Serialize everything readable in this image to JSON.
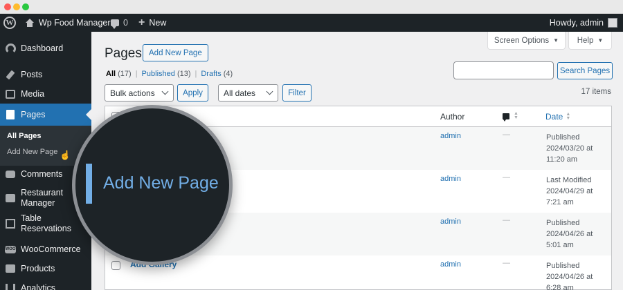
{
  "adminbar": {
    "site_name": "Wp Food Manager",
    "comments_count": "0",
    "new_label": "New",
    "howdy": "Howdy, admin"
  },
  "sidebar": {
    "items": [
      {
        "label": "Dashboard",
        "icon": "dashboard-icon"
      },
      {
        "label": "Posts",
        "icon": "pin-icon"
      },
      {
        "label": "Media",
        "icon": "media-icon"
      },
      {
        "label": "Pages",
        "icon": "page-icon",
        "current": true
      },
      {
        "label": "Comments",
        "icon": "comment-icon"
      },
      {
        "label": "Restaurant Manager",
        "icon": "restaurant-icon"
      },
      {
        "label": "Table Reservations",
        "icon": "table-icon"
      },
      {
        "label": "WooCommerce",
        "icon": "woocommerce-icon"
      },
      {
        "label": "Products",
        "icon": "products-icon"
      },
      {
        "label": "Analytics",
        "icon": "analytics-icon"
      }
    ],
    "submenu": [
      {
        "label": "All Pages",
        "active": true
      },
      {
        "label": "Add New Page",
        "active": false
      }
    ]
  },
  "header": {
    "screen_options": "Screen Options",
    "help": "Help",
    "title": "Pages",
    "add_new": "Add New Page"
  },
  "filters": {
    "all_label": "All",
    "all_count": "(17)",
    "published_label": "Published",
    "published_count": "(13)",
    "drafts_label": "Drafts",
    "drafts_count": "(4)",
    "bulk_actions": "Bulk actions",
    "apply": "Apply",
    "all_dates": "All dates",
    "filter": "Filter",
    "search_button": "Search Pages",
    "items_count": "17 items"
  },
  "table": {
    "columns": {
      "author": "Author",
      "date": "Date"
    },
    "rows": [
      {
        "title": "",
        "author": "admin",
        "comments": "—",
        "date_status": "Published",
        "date_value": "2024/03/20 at 11:20 am"
      },
      {
        "title": "",
        "author": "admin",
        "comments": "—",
        "date_status": "Last Modified",
        "date_value": "2024/04/29 at 7:21 am"
      },
      {
        "title": "",
        "author": "admin",
        "comments": "—",
        "date_status": "Published",
        "date_value": "2024/04/26 at 5:01 am"
      },
      {
        "title": "Add Gallery",
        "author": "admin",
        "comments": "—",
        "date_status": "Published",
        "date_value": "2024/04/26 at 6:28 am"
      }
    ]
  },
  "magnifier": {
    "label": "Add New Page"
  },
  "colors": {
    "accent": "#2271b1",
    "adminbar": "#1d2327",
    "highlight": "#72aee6"
  }
}
